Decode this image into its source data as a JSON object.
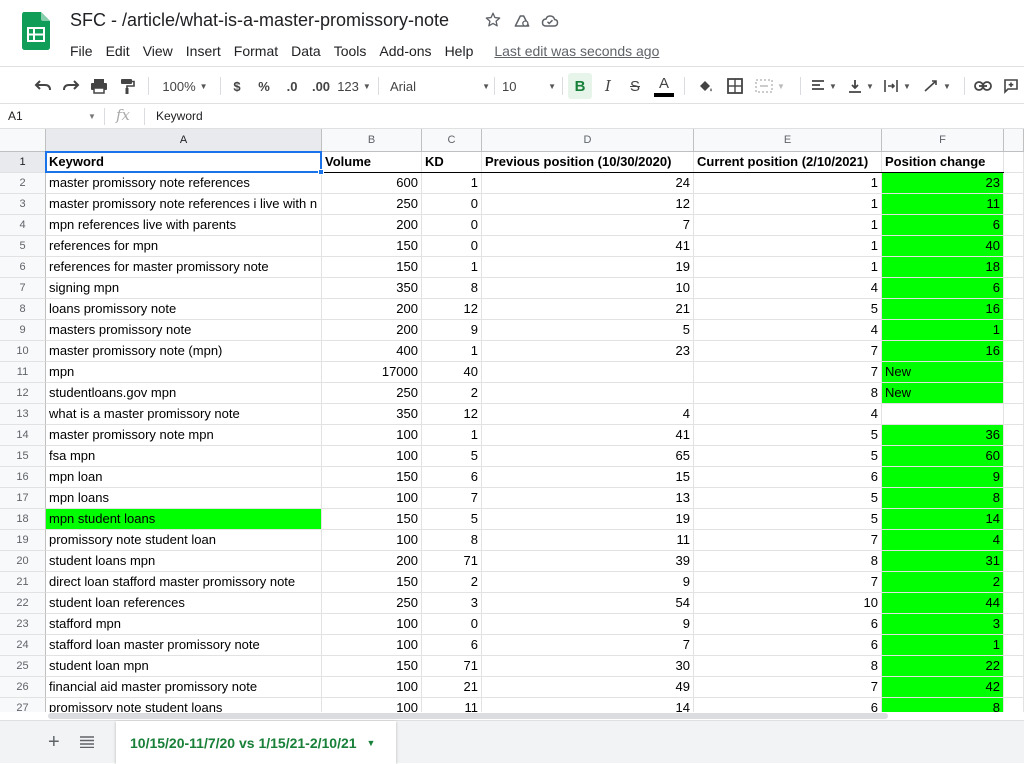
{
  "app": {
    "brand_color": "#0f9d58",
    "accent": "#1a73e8",
    "highlight_green": "#00ff00"
  },
  "header": {
    "title": "SFC - /article/what-is-a-master-promissory-note",
    "title_icons": [
      "star-icon",
      "move-to-folder-icon",
      "cloud-saved-icon"
    ],
    "menu": [
      "File",
      "Edit",
      "View",
      "Insert",
      "Format",
      "Data",
      "Tools",
      "Add-ons",
      "Help"
    ],
    "last_edit": "Last edit was seconds ago"
  },
  "toolbar": {
    "zoom": "100%",
    "currency": "$",
    "percent": "%",
    "decrease_decimal": ".0",
    "increase_decimal": ".00",
    "more_formats": "123",
    "font": "Arial",
    "font_size": "10",
    "bold": "B",
    "italic": "I",
    "strikethrough": "S",
    "text_color": "A"
  },
  "formula_bar": {
    "name_box": "A1",
    "fx": "fx",
    "content": "Keyword"
  },
  "grid": {
    "columns": [
      "A",
      "B",
      "C",
      "D",
      "E",
      "F"
    ],
    "header_row": {
      "row": "1",
      "cells": [
        "Keyword",
        "Volume",
        "KD",
        "Previous position (10/30/2020)",
        "Current position (2/10/2021)",
        "Position change"
      ]
    },
    "rows": [
      {
        "n": "2",
        "kw": "master promissory note references",
        "vol": "600",
        "kd": "1",
        "prev": "24",
        "cur": "1",
        "chg": "23",
        "green": true
      },
      {
        "n": "3",
        "kw": "master promissory note references i live with n",
        "vol": "250",
        "kd": "0",
        "prev": "12",
        "cur": "1",
        "chg": "11",
        "green": true
      },
      {
        "n": "4",
        "kw": "mpn references live with parents",
        "vol": "200",
        "kd": "0",
        "prev": "7",
        "cur": "1",
        "chg": "6",
        "green": true
      },
      {
        "n": "5",
        "kw": "references for mpn",
        "vol": "150",
        "kd": "0",
        "prev": "41",
        "cur": "1",
        "chg": "40",
        "green": true
      },
      {
        "n": "6",
        "kw": "references for master promissory note",
        "vol": "150",
        "kd": "1",
        "prev": "19",
        "cur": "1",
        "chg": "18",
        "green": true
      },
      {
        "n": "7",
        "kw": "signing mpn",
        "vol": "350",
        "kd": "8",
        "prev": "10",
        "cur": "4",
        "chg": "6",
        "green": true
      },
      {
        "n": "8",
        "kw": "loans promissory note",
        "vol": "200",
        "kd": "12",
        "prev": "21",
        "cur": "5",
        "chg": "16",
        "green": true
      },
      {
        "n": "9",
        "kw": "masters promissory note",
        "vol": "200",
        "kd": "9",
        "prev": "5",
        "cur": "4",
        "chg": "1",
        "green": true
      },
      {
        "n": "10",
        "kw": "master promissory note (mpn)",
        "vol": "400",
        "kd": "1",
        "prev": "23",
        "cur": "7",
        "chg": "16",
        "green": true
      },
      {
        "n": "11",
        "kw": "mpn",
        "vol": "17000",
        "kd": "40",
        "prev": "",
        "cur": "7",
        "chg": "New",
        "green": true,
        "left": true
      },
      {
        "n": "12",
        "kw": "studentloans.gov mpn",
        "vol": "250",
        "kd": "2",
        "prev": "",
        "cur": "8",
        "chg": "New",
        "green": true,
        "left": true
      },
      {
        "n": "13",
        "kw": "what is a master promissory note",
        "vol": "350",
        "kd": "12",
        "prev": "4",
        "cur": "4",
        "chg": "",
        "green": false
      },
      {
        "n": "14",
        "kw": "master promissory note mpn",
        "vol": "100",
        "kd": "1",
        "prev": "41",
        "cur": "5",
        "chg": "36",
        "green": true
      },
      {
        "n": "15",
        "kw": "fsa mpn",
        "vol": "100",
        "kd": "5",
        "prev": "65",
        "cur": "5",
        "chg": "60",
        "green": true
      },
      {
        "n": "16",
        "kw": "mpn loan",
        "vol": "150",
        "kd": "6",
        "prev": "15",
        "cur": "6",
        "chg": "9",
        "green": true
      },
      {
        "n": "17",
        "kw": "mpn loans",
        "vol": "100",
        "kd": "7",
        "prev": "13",
        "cur": "5",
        "chg": "8",
        "green": true
      },
      {
        "n": "18",
        "kw": "mpn student loans",
        "vol": "150",
        "kd": "5",
        "prev": "19",
        "cur": "5",
        "chg": "14",
        "green": true,
        "kwgreen": true
      },
      {
        "n": "19",
        "kw": "promissory note student loan",
        "vol": "100",
        "kd": "8",
        "prev": "11",
        "cur": "7",
        "chg": "4",
        "green": true
      },
      {
        "n": "20",
        "kw": "student loans mpn",
        "vol": "200",
        "kd": "71",
        "prev": "39",
        "cur": "8",
        "chg": "31",
        "green": true
      },
      {
        "n": "21",
        "kw": "direct loan stafford master promissory note",
        "vol": "150",
        "kd": "2",
        "prev": "9",
        "cur": "7",
        "chg": "2",
        "green": true
      },
      {
        "n": "22",
        "kw": "student loan references",
        "vol": "250",
        "kd": "3",
        "prev": "54",
        "cur": "10",
        "chg": "44",
        "green": true
      },
      {
        "n": "23",
        "kw": "stafford mpn",
        "vol": "100",
        "kd": "0",
        "prev": "9",
        "cur": "6",
        "chg": "3",
        "green": true
      },
      {
        "n": "24",
        "kw": "stafford loan master promissory note",
        "vol": "100",
        "kd": "6",
        "prev": "7",
        "cur": "6",
        "chg": "1",
        "green": true
      },
      {
        "n": "25",
        "kw": "student loan mpn",
        "vol": "150",
        "kd": "71",
        "prev": "30",
        "cur": "8",
        "chg": "22",
        "green": true
      },
      {
        "n": "26",
        "kw": "financial aid master promissory note",
        "vol": "100",
        "kd": "21",
        "prev": "49",
        "cur": "7",
        "chg": "42",
        "green": true
      },
      {
        "n": "27",
        "kw": "promissory note student loans",
        "vol": "100",
        "kd": "11",
        "prev": "14",
        "cur": "6",
        "chg": "8",
        "green": true
      }
    ]
  },
  "sheet_bar": {
    "add_label": "+",
    "active_tab": "10/15/20-11/7/20 vs 1/15/21-2/10/21"
  }
}
